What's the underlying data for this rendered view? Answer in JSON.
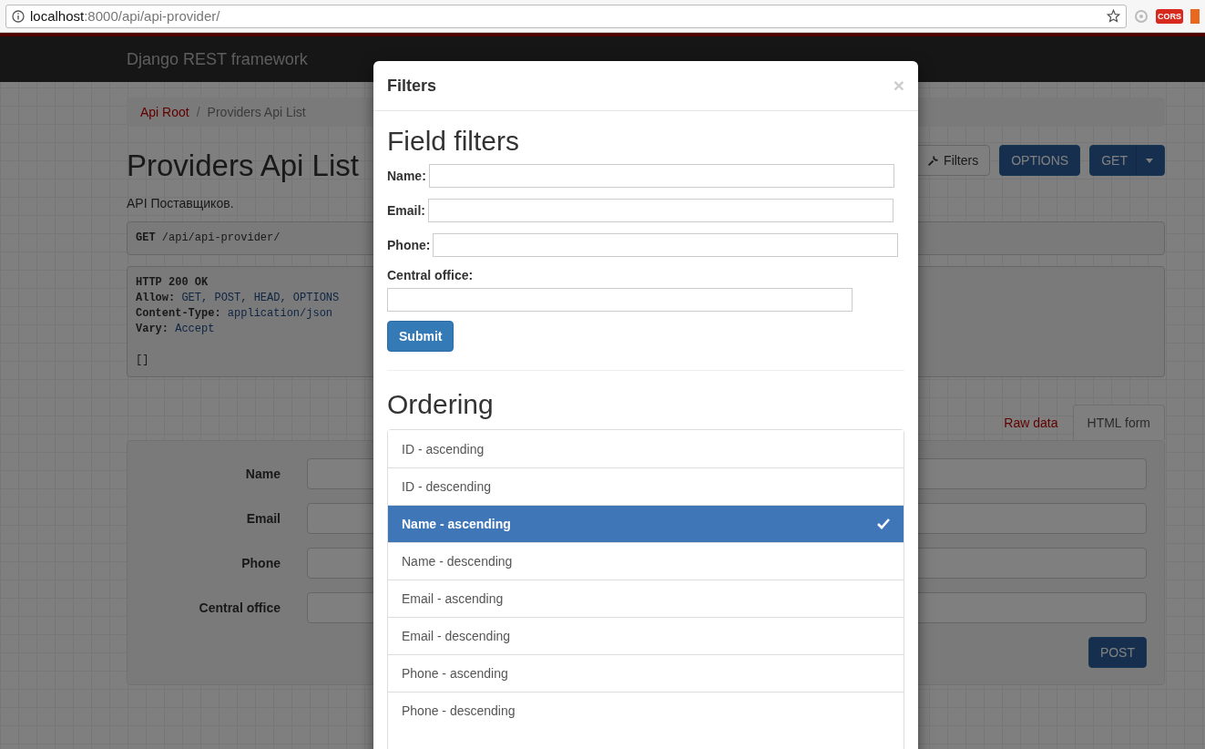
{
  "browser": {
    "url_host": "localhost",
    "url_path": ":8000/api/api-provider/",
    "extension_badge": "CORS"
  },
  "navbar": {
    "brand": "Django REST framework"
  },
  "breadcrumb_separator": "/",
  "breadcrumb": [
    {
      "label": "Api Root",
      "selected": false
    },
    {
      "label": "Providers Api List",
      "selected": true
    }
  ],
  "page": {
    "title": "Providers Api List",
    "description": "API Поставщиков.",
    "header_buttons": [
      {
        "label": "Filters",
        "kind": "filters"
      },
      {
        "label": "OPTIONS",
        "kind": "primary"
      },
      {
        "label": "GET",
        "kind": "split"
      }
    ],
    "request": {
      "method": "GET",
      "path": "/api/api-provider/"
    },
    "response": {
      "status": "HTTP 200 OK",
      "headers": [
        {
          "name": "Allow:",
          "value": "GET, POST, HEAD, OPTIONS"
        },
        {
          "name": "Content-Type:",
          "value": "application/json"
        },
        {
          "name": "Vary:",
          "value": "Accept"
        }
      ],
      "body": "[]"
    },
    "form_tabs": [
      {
        "label": "Raw data",
        "selected": false
      },
      {
        "label": "HTML form",
        "selected": true
      }
    ],
    "form_fields": [
      "Name",
      "Email",
      "Phone",
      "Central office"
    ],
    "submit": "POST"
  },
  "modal": {
    "title": "Filters",
    "close": "×",
    "field_filters_heading": "Field filters",
    "fields": [
      {
        "label": "Name:",
        "kind": "inline"
      },
      {
        "label": "Email:",
        "kind": "inline"
      },
      {
        "label": "Phone:",
        "kind": "inline"
      },
      {
        "label": "Central office:",
        "kind": "stacked"
      }
    ],
    "submit": "Submit",
    "ordering_heading": "Ordering",
    "ordering": [
      {
        "label": "ID - ascending",
        "selected": false
      },
      {
        "label": "ID - descending",
        "selected": false
      },
      {
        "label": "Name - ascending",
        "selected": true
      },
      {
        "label": "Name - descending",
        "selected": false
      },
      {
        "label": "Email - ascending",
        "selected": false
      },
      {
        "label": "Email - descending",
        "selected": false
      },
      {
        "label": "Phone - ascending",
        "selected": false
      },
      {
        "label": "Phone - descending",
        "selected": false
      }
    ]
  }
}
